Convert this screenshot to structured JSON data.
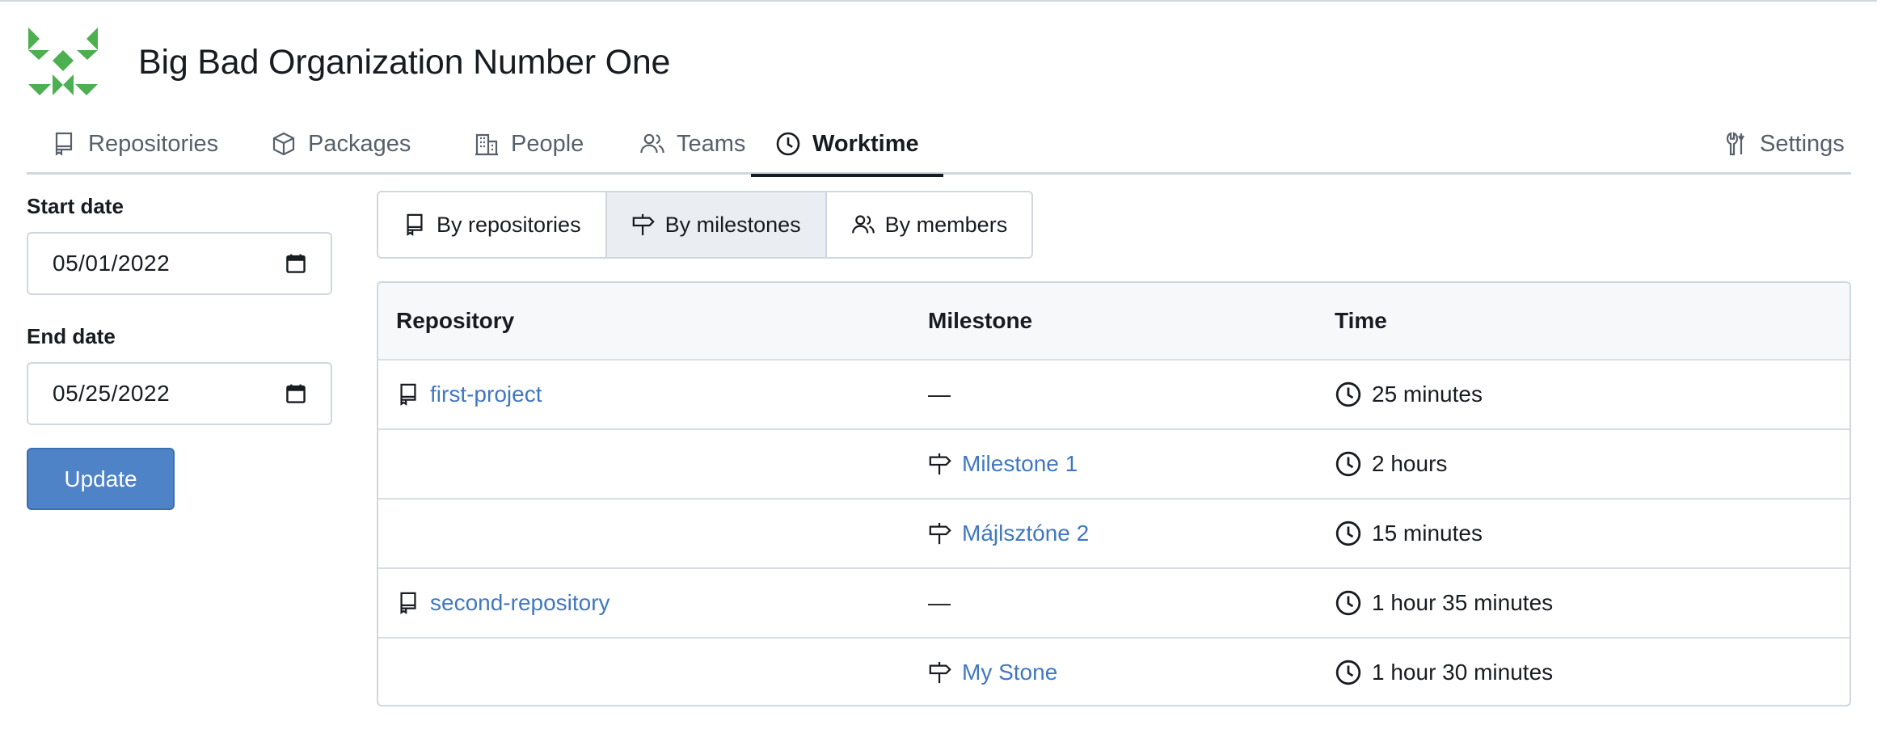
{
  "org": {
    "name": "Big Bad Organization Number One",
    "logo_color": "#4caf50"
  },
  "tabs": [
    {
      "label": "Repositories",
      "icon": "repo-icon"
    },
    {
      "label": "Packages",
      "icon": "package-icon"
    },
    {
      "label": "People",
      "icon": "organization-icon"
    },
    {
      "label": "Teams",
      "icon": "people-icon"
    },
    {
      "label": "Worktime",
      "icon": "clock-icon",
      "active": true
    },
    {
      "label": "Settings",
      "icon": "tools-icon"
    }
  ],
  "filters": {
    "start_label": "Start date",
    "start_value": "05/01/2022",
    "end_label": "End date",
    "end_value": "05/25/2022",
    "update_label": "Update"
  },
  "views": [
    {
      "label": "By repositories",
      "icon": "repo-icon"
    },
    {
      "label": "By milestones",
      "icon": "milestone-icon",
      "active": true
    },
    {
      "label": "By members",
      "icon": "people-icon"
    }
  ],
  "table": {
    "headers": {
      "repository": "Repository",
      "milestone": "Milestone",
      "time": "Time"
    },
    "rows": [
      {
        "repository": "first-project",
        "milestone": "—",
        "time": "25 minutes"
      },
      {
        "repository": "",
        "milestone": "Milestone 1",
        "time": "2 hours"
      },
      {
        "repository": "",
        "milestone": "Májlsztóne 2",
        "time": "15 minutes"
      },
      {
        "repository": "second-repository",
        "milestone": "—",
        "time": "1 hour 35 minutes"
      },
      {
        "repository": "",
        "milestone": "My Stone",
        "time": "1 hour 30 minutes"
      }
    ]
  },
  "colors": {
    "accent": "#4f83c7",
    "link": "#4078c0",
    "border": "#d0d7de"
  }
}
